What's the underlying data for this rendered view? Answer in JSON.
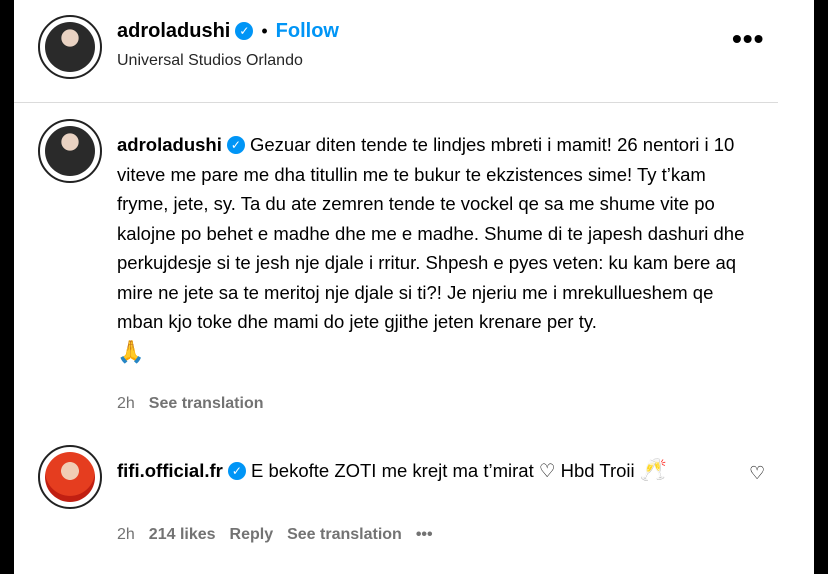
{
  "header": {
    "username": "adroladushi",
    "separator": "•",
    "follow_label": "Follow",
    "location": "Universal Studios Orlando",
    "more_icon": "•••"
  },
  "caption": {
    "username": "adroladushi",
    "text": "Gezuar diten tende te lindjes mbreti i mamit! 26 nentori i 10 viteve me pare me dha titullin me te bukur te ekzistences sime! Ty t’kam fryme, jete, sy. Ta du ate zemren tende te vockel qe sa me shume vite po kalojne po behet e madhe dhe me e madhe. Shume di te japesh dashuri dhe perkujdesje si te jesh nje djale i rritur. Shpesh e pyes veten: ku kam bere aq mire ne jete sa te meritoj nje djale si ti?! Je njeriu me i mrekullueshem qe mban kjo toke dhe mami do jete gjithe jeten krenare per ty.",
    "emoji": "🙏",
    "time": "2h",
    "see_translation": "See translation"
  },
  "comment": {
    "username": "fifi.official.fr",
    "text_before": "E bekofte ZOTI me krejt ma t’mirat",
    "heart_emoji": "♡",
    "text_after": "Hbd Troii",
    "emoji": "🥂",
    "time": "2h",
    "likes": "214 likes",
    "reply": "Reply",
    "see_translation": "See translation",
    "more": "•••",
    "like_icon": "♡"
  },
  "icons": {
    "verified": "✓"
  }
}
